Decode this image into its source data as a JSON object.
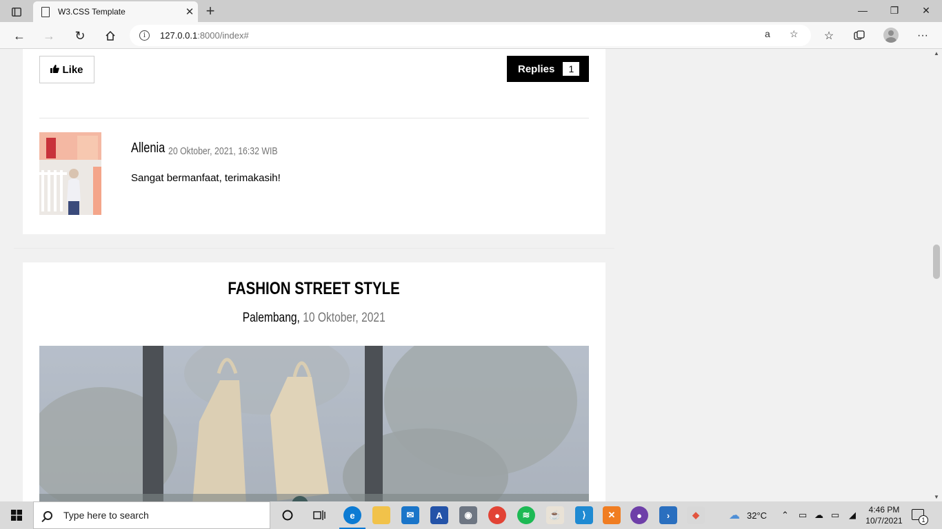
{
  "browser": {
    "tab_title": "W3.CSS Template",
    "url_host": "127.0.0.1",
    "url_rest": ":8000/index#"
  },
  "page": {
    "like_label": "Like",
    "replies_label": "Replies",
    "replies_count": "1",
    "comment": {
      "author": "Allenia",
      "date": "20 Oktober, 2021, 16:32 WIB",
      "text": "Sangat bermanfaat, terimakasih!"
    },
    "post": {
      "title": "FASHION STREET STYLE",
      "place": "Palembang,",
      "date": "10 Oktober, 2021"
    }
  },
  "taskbar": {
    "search_placeholder": "Type here to search",
    "weather": "32°C",
    "time": "4:46 PM",
    "date": "10/7/2021",
    "notification_count": "1"
  }
}
